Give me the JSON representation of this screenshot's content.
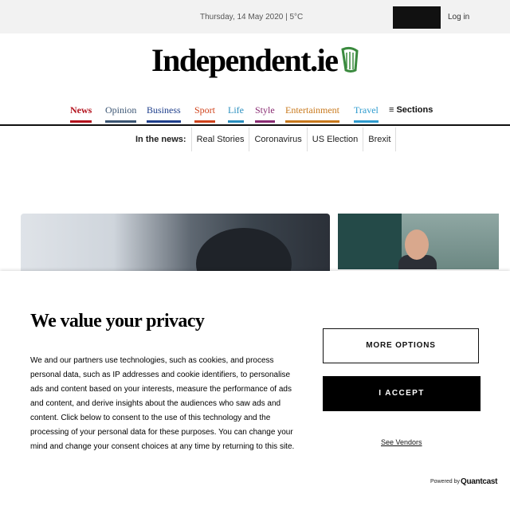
{
  "header": {
    "date_weather": "Thursday, 14 May 2020 | 5°C",
    "login_label": "Log in",
    "logo_text": "Independent.ie"
  },
  "nav": {
    "items": [
      {
        "label": "News",
        "color": "#b3121d",
        "active": true
      },
      {
        "label": "Opinion",
        "color": "#3b5573",
        "active": false
      },
      {
        "label": "Business",
        "color": "#1f3f8c",
        "active": false
      },
      {
        "label": "Sport",
        "color": "#d0431c",
        "active": false
      },
      {
        "label": "Life",
        "color": "#2a8fbf",
        "active": false
      },
      {
        "label": "Style",
        "color": "#8a2d73",
        "active": false
      },
      {
        "label": "Entertainment",
        "color": "#c8791d",
        "active": false
      },
      {
        "label": "Travel",
        "color": "#2f9ccf",
        "active": false
      }
    ],
    "sections_label": "≡ Sections"
  },
  "in_the_news": {
    "label": "In the news:",
    "items": [
      "Real Stories",
      "Coronavirus",
      "US Election",
      "Brexit"
    ]
  },
  "consent": {
    "title": "We value your privacy",
    "body": "We and our partners use technologies, such as cookies, and process personal data, such as IP addresses and cookie identifiers, to personalise ads and content based on your interests, measure the performance of ads and content, and derive insights about the audiences who saw ads and content. Click below to consent to the use of this technology and the processing of your personal data for these purposes. You can change your mind and change your consent choices at any time by returning to this site.",
    "more_options": "MORE OPTIONS",
    "accept": "I ACCEPT",
    "see_vendors": "See Vendors",
    "powered_by": "Powered by",
    "quantcast": "Quantcast"
  },
  "colors": {
    "accent_dark": "#000000",
    "logo_harp": "#3a8a3e"
  }
}
